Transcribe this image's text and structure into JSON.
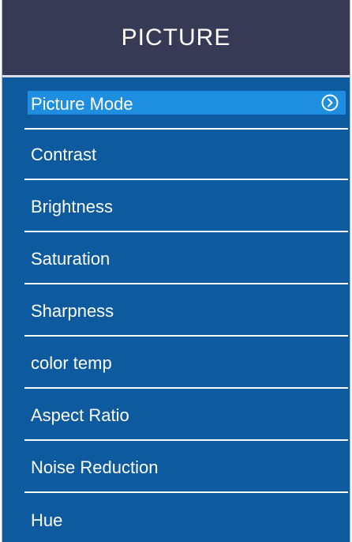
{
  "header": {
    "title": "PICTURE"
  },
  "menu": {
    "items": [
      {
        "label": "Picture Mode",
        "selected": true,
        "icon": "chevron-right-circle-icon"
      },
      {
        "label": "Contrast"
      },
      {
        "label": "Brightness"
      },
      {
        "label": "Saturation"
      },
      {
        "label": "Sharpness"
      },
      {
        "label": "color temp"
      },
      {
        "label": "Aspect Ratio"
      },
      {
        "label": "Noise Reduction"
      },
      {
        "label": "Hue"
      }
    ]
  },
  "colors": {
    "header_bg": "#363a54",
    "menu_bg": "#0d5a9e",
    "highlight": "#1e8ee0",
    "text": "#ffffff"
  }
}
